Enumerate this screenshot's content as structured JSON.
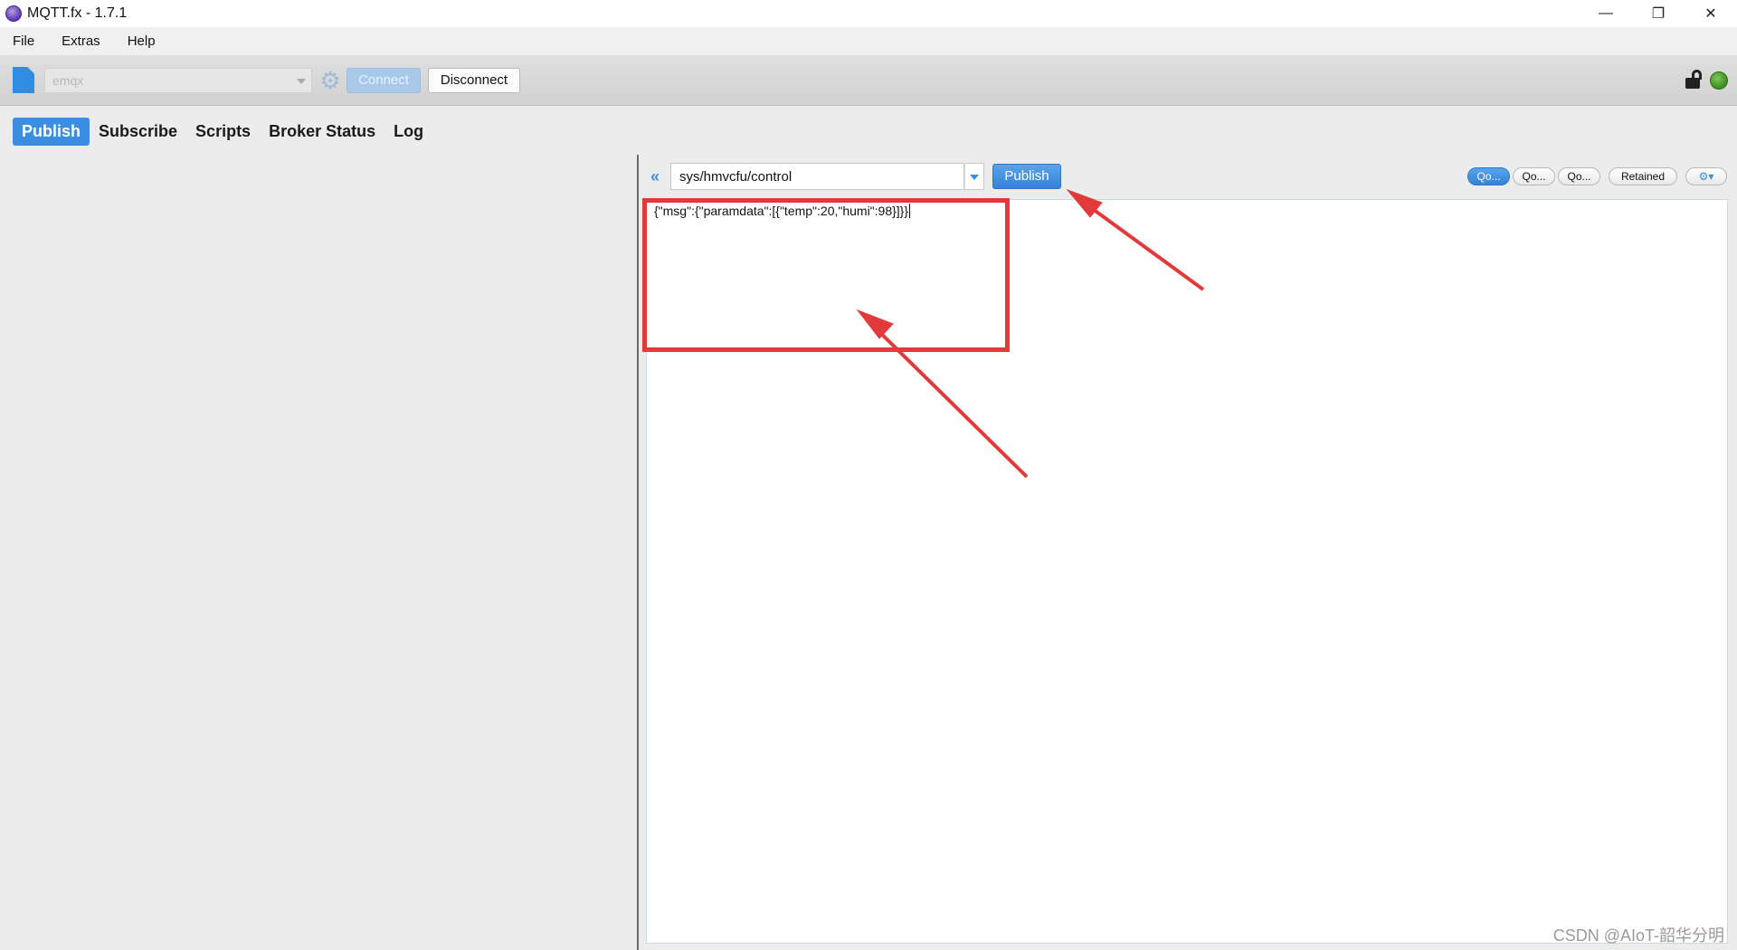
{
  "window": {
    "title": "MQTT.fx - 1.7.1",
    "controls": {
      "minimize": "—",
      "restore": "❐",
      "close": "✕"
    }
  },
  "menu": {
    "items": [
      "File",
      "Extras",
      "Help"
    ]
  },
  "toolbar": {
    "profile_value": "emqx",
    "connect_label": "Connect",
    "disconnect_label": "Disconnect",
    "connection_status_color": "#3c8c1e"
  },
  "tabs": [
    {
      "label": "Publish",
      "active": true
    },
    {
      "label": "Subscribe",
      "active": false
    },
    {
      "label": "Scripts",
      "active": false
    },
    {
      "label": "Broker Status",
      "active": false
    },
    {
      "label": "Log",
      "active": false
    }
  ],
  "publish": {
    "collapse_glyph": "«",
    "topic": "sys/hmvcfu/control",
    "publish_label": "Publish",
    "qos_options": [
      {
        "label": "Qo...",
        "active": true
      },
      {
        "label": "Qo...",
        "active": false
      },
      {
        "label": "Qo...",
        "active": false
      }
    ],
    "retained_label": "Retained",
    "options_glyph": "⚙▾",
    "payload": "{\"msg\":{\"paramdata\":[{\"temp\":20,\"humi\":98}]}}"
  },
  "annotations": {
    "color": "#e23a3a"
  },
  "watermark": "CSDN @AIoT-韶华分明",
  "colors": {
    "accent": "#3b8ee0",
    "background": "#ececec"
  }
}
